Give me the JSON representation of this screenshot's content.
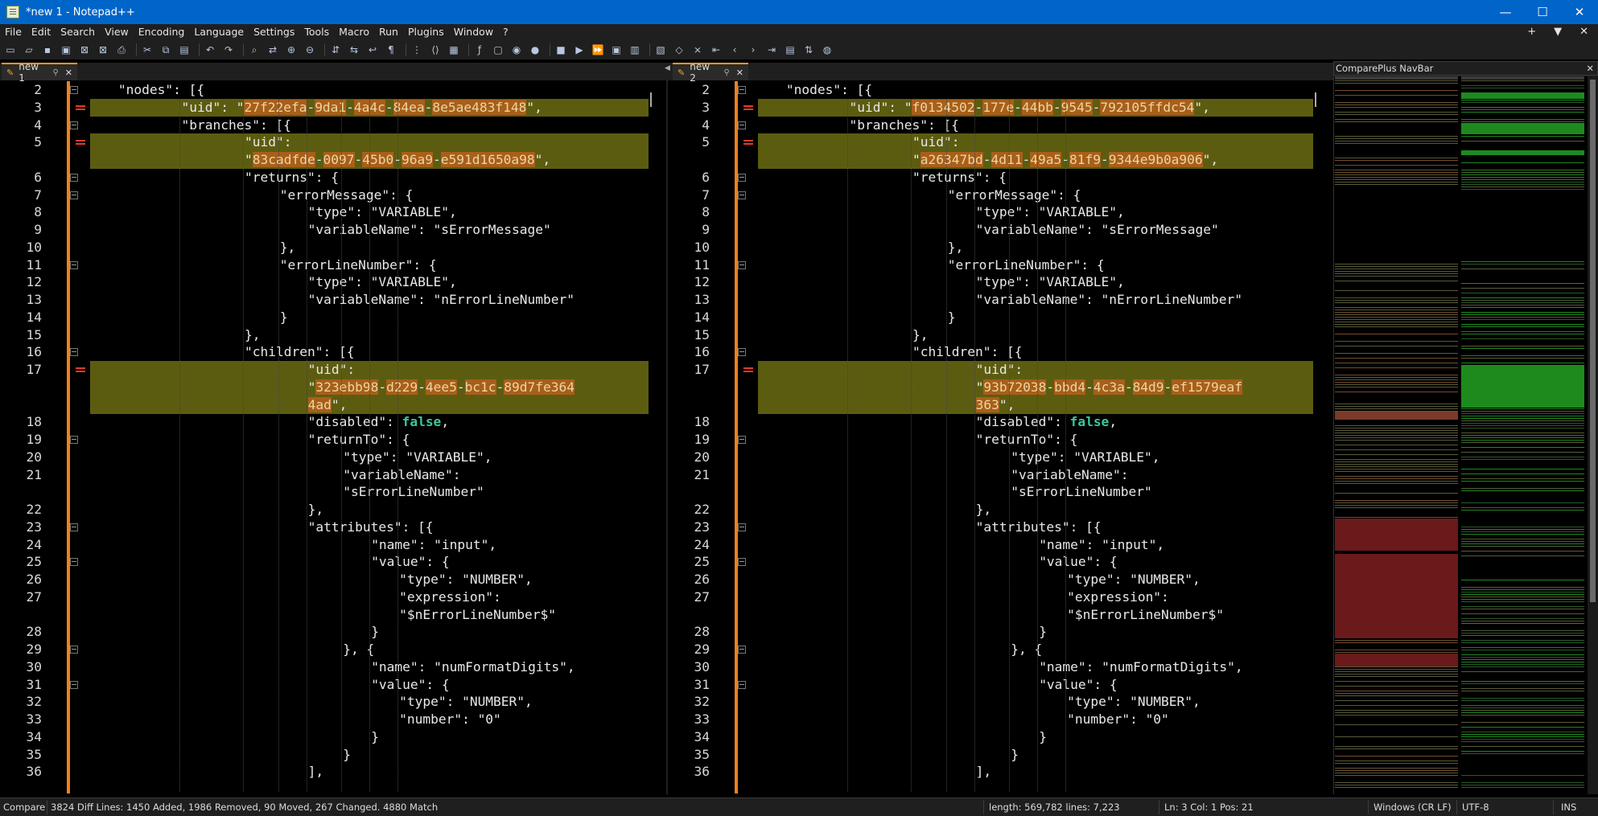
{
  "window": {
    "title": "*new 1 - Notepad++",
    "minimize": "—",
    "maximize": "☐",
    "close": "✕"
  },
  "menu": [
    "File",
    "Edit",
    "Search",
    "View",
    "Encoding",
    "Language",
    "Settings",
    "Tools",
    "Macro",
    "Run",
    "Plugins",
    "Window",
    "?"
  ],
  "menu_right": {
    "add": "+",
    "dropdown": "▼",
    "close": "✕"
  },
  "tabs": {
    "left": {
      "label": "new 1"
    },
    "right": {
      "label": "new 2"
    }
  },
  "navbar": {
    "title": "ComparePlus NavBar"
  },
  "left_pane": {
    "lines": [
      {
        "n": "2",
        "indent": 4,
        "text": "\"nodes\": [{",
        "kind": "plain",
        "fold": true
      },
      {
        "n": "3",
        "indent": 13,
        "text": "\"uid\": \"27f22efa-9da1-4a4c-84ea-8e5ae483f148\",",
        "kind": "diff",
        "uid": "27f22efa-9da1-4a4c-84ea-8e5ae483f148",
        "key": "\"uid\": ",
        "tail": ","
      },
      {
        "n": "4",
        "indent": 13,
        "text": "\"branches\": [{",
        "kind": "plain",
        "fold": true
      },
      {
        "n": "5",
        "indent": 22,
        "text": "\"uid\":",
        "kind": "diff",
        "mark": true
      },
      {
        "n": "",
        "indent": 22,
        "text": "\"83cadfde-0097-45b0-96a9-e591d1650a98\",",
        "kind": "diffuid",
        "uid": "83cadfde-0097-45b0-96a9-e591d1650a98",
        "tail": ","
      },
      {
        "n": "6",
        "indent": 22,
        "text": "\"returns\": {",
        "kind": "plain",
        "fold": true
      },
      {
        "n": "7",
        "indent": 27,
        "text": "\"errorMessage\": {",
        "kind": "plain",
        "fold": true
      },
      {
        "n": "8",
        "indent": 31,
        "text": "\"type\": \"VARIABLE\",",
        "kind": "plain"
      },
      {
        "n": "9",
        "indent": 31,
        "text": "\"variableName\": \"sErrorMessage\"",
        "kind": "plain"
      },
      {
        "n": "10",
        "indent": 27,
        "text": "},",
        "kind": "plain"
      },
      {
        "n": "11",
        "indent": 27,
        "text": "\"errorLineNumber\": {",
        "kind": "plain",
        "fold": true
      },
      {
        "n": "12",
        "indent": 31,
        "text": "\"type\": \"VARIABLE\",",
        "kind": "plain"
      },
      {
        "n": "13",
        "indent": 31,
        "text": "\"variableName\": \"nErrorLineNumber\"",
        "kind": "plain"
      },
      {
        "n": "14",
        "indent": 27,
        "text": "}",
        "kind": "plain"
      },
      {
        "n": "15",
        "indent": 22,
        "text": "},",
        "kind": "plain"
      },
      {
        "n": "16",
        "indent": 22,
        "text": "\"children\": [{",
        "kind": "plain",
        "fold": true
      },
      {
        "n": "17",
        "indent": 31,
        "text": "\"uid\":",
        "kind": "diff",
        "mark": true
      },
      {
        "n": "",
        "indent": 31,
        "text": "\"323ebb98-d229-4ee5-bc1c-89d7fe364",
        "kind": "diffuid",
        "uid": "323ebb98-d229-4ee5-bc1c-89d7fe364",
        "tail": ""
      },
      {
        "n": "",
        "indent": 31,
        "text": "4ad\",",
        "kind": "diffuid",
        "uid": "4ad",
        "tail": ","
      },
      {
        "n": "18",
        "indent": 31,
        "text": "\"disabled\": false,",
        "kind": "bool"
      },
      {
        "n": "19",
        "indent": 31,
        "text": "\"returnTo\": {",
        "kind": "plain",
        "fold": true
      },
      {
        "n": "20",
        "indent": 36,
        "text": "\"type\": \"VARIABLE\",",
        "kind": "plain"
      },
      {
        "n": "21",
        "indent": 36,
        "text": "\"variableName\":",
        "kind": "plain"
      },
      {
        "n": "",
        "indent": 36,
        "text": "\"sErrorLineNumber\"",
        "kind": "plain"
      },
      {
        "n": "22",
        "indent": 31,
        "text": "},",
        "kind": "plain"
      },
      {
        "n": "23",
        "indent": 31,
        "text": "\"attributes\": [{",
        "kind": "plain",
        "fold": true
      },
      {
        "n": "24",
        "indent": 40,
        "text": "\"name\": \"input\",",
        "kind": "plain"
      },
      {
        "n": "25",
        "indent": 40,
        "text": "\"value\": {",
        "kind": "plain",
        "fold": true
      },
      {
        "n": "26",
        "indent": 44,
        "text": "\"type\": \"NUMBER\",",
        "kind": "plain"
      },
      {
        "n": "27",
        "indent": 44,
        "text": "\"expression\":",
        "kind": "plain"
      },
      {
        "n": "",
        "indent": 44,
        "text": "\"$nErrorLineNumber$\"",
        "kind": "plain"
      },
      {
        "n": "28",
        "indent": 40,
        "text": "}",
        "kind": "plain"
      },
      {
        "n": "29",
        "indent": 36,
        "text": "}, {",
        "kind": "plain",
        "fold": true
      },
      {
        "n": "30",
        "indent": 40,
        "text": "\"name\": \"numFormatDigits\",",
        "kind": "plain"
      },
      {
        "n": "31",
        "indent": 40,
        "text": "\"value\": {",
        "kind": "plain",
        "fold": true
      },
      {
        "n": "32",
        "indent": 44,
        "text": "\"type\": \"NUMBER\",",
        "kind": "plain"
      },
      {
        "n": "33",
        "indent": 44,
        "text": "\"number\": \"0\"",
        "kind": "plain"
      },
      {
        "n": "34",
        "indent": 40,
        "text": "}",
        "kind": "plain"
      },
      {
        "n": "35",
        "indent": 36,
        "text": "}",
        "kind": "plain"
      },
      {
        "n": "36",
        "indent": 31,
        "text": "],",
        "kind": "plain"
      }
    ]
  },
  "right_pane": {
    "lines": [
      {
        "n": "2",
        "indent": 4,
        "text": "\"nodes\": [{",
        "kind": "plain",
        "fold": true
      },
      {
        "n": "3",
        "indent": 13,
        "text": "\"uid\": \"f0134502-177e-44bb-9545-792105ffdc54\",",
        "kind": "diff",
        "uid": "f0134502-177e-44bb-9545-792105ffdc54",
        "key": "\"uid\": ",
        "tail": ","
      },
      {
        "n": "4",
        "indent": 13,
        "text": "\"branches\": [{",
        "kind": "plain",
        "fold": true
      },
      {
        "n": "5",
        "indent": 22,
        "text": "\"uid\":",
        "kind": "diff",
        "mark": true
      },
      {
        "n": "",
        "indent": 22,
        "text": "\"a26347bd-4d11-49a5-81f9-9344e9b0a906\",",
        "kind": "diffuid",
        "uid": "a26347bd-4d11-49a5-81f9-9344e9b0a906",
        "tail": ","
      },
      {
        "n": "6",
        "indent": 22,
        "text": "\"returns\": {",
        "kind": "plain",
        "fold": true
      },
      {
        "n": "7",
        "indent": 27,
        "text": "\"errorMessage\": {",
        "kind": "plain",
        "fold": true
      },
      {
        "n": "8",
        "indent": 31,
        "text": "\"type\": \"VARIABLE\",",
        "kind": "plain"
      },
      {
        "n": "9",
        "indent": 31,
        "text": "\"variableName\": \"sErrorMessage\"",
        "kind": "plain"
      },
      {
        "n": "10",
        "indent": 27,
        "text": "},",
        "kind": "plain"
      },
      {
        "n": "11",
        "indent": 27,
        "text": "\"errorLineNumber\": {",
        "kind": "plain",
        "fold": true
      },
      {
        "n": "12",
        "indent": 31,
        "text": "\"type\": \"VARIABLE\",",
        "kind": "plain"
      },
      {
        "n": "13",
        "indent": 31,
        "text": "\"variableName\": \"nErrorLineNumber\"",
        "kind": "plain"
      },
      {
        "n": "14",
        "indent": 27,
        "text": "}",
        "kind": "plain"
      },
      {
        "n": "15",
        "indent": 22,
        "text": "},",
        "kind": "plain"
      },
      {
        "n": "16",
        "indent": 22,
        "text": "\"children\": [{",
        "kind": "plain",
        "fold": true
      },
      {
        "n": "17",
        "indent": 31,
        "text": "\"uid\":",
        "kind": "diff",
        "mark": true
      },
      {
        "n": "",
        "indent": 31,
        "text": "\"93b72038-bbd4-4c3a-84d9-ef1579eaf",
        "kind": "diffuid",
        "uid": "93b72038-bbd4-4c3a-84d9-ef1579eaf",
        "tail": ""
      },
      {
        "n": "",
        "indent": 31,
        "text": "363\",",
        "kind": "diffuid",
        "uid": "363",
        "tail": ","
      },
      {
        "n": "18",
        "indent": 31,
        "text": "\"disabled\": false,",
        "kind": "bool"
      },
      {
        "n": "19",
        "indent": 31,
        "text": "\"returnTo\": {",
        "kind": "plain",
        "fold": true
      },
      {
        "n": "20",
        "indent": 36,
        "text": "\"type\": \"VARIABLE\",",
        "kind": "plain"
      },
      {
        "n": "21",
        "indent": 36,
        "text": "\"variableName\":",
        "kind": "plain"
      },
      {
        "n": "",
        "indent": 36,
        "text": "\"sErrorLineNumber\"",
        "kind": "plain"
      },
      {
        "n": "22",
        "indent": 31,
        "text": "},",
        "kind": "plain"
      },
      {
        "n": "23",
        "indent": 31,
        "text": "\"attributes\": [{",
        "kind": "plain",
        "fold": true
      },
      {
        "n": "24",
        "indent": 40,
        "text": "\"name\": \"input\",",
        "kind": "plain"
      },
      {
        "n": "25",
        "indent": 40,
        "text": "\"value\": {",
        "kind": "plain",
        "fold": true
      },
      {
        "n": "26",
        "indent": 44,
        "text": "\"type\": \"NUMBER\",",
        "kind": "plain"
      },
      {
        "n": "27",
        "indent": 44,
        "text": "\"expression\":",
        "kind": "plain"
      },
      {
        "n": "",
        "indent": 44,
        "text": "\"$nErrorLineNumber$\"",
        "kind": "plain"
      },
      {
        "n": "28",
        "indent": 40,
        "text": "}",
        "kind": "plain"
      },
      {
        "n": "29",
        "indent": 36,
        "text": "}, {",
        "kind": "plain",
        "fold": true
      },
      {
        "n": "30",
        "indent": 40,
        "text": "\"name\": \"numFormatDigits\",",
        "kind": "plain"
      },
      {
        "n": "31",
        "indent": 40,
        "text": "\"value\": {",
        "kind": "plain",
        "fold": true
      },
      {
        "n": "32",
        "indent": 44,
        "text": "\"type\": \"NUMBER\",",
        "kind": "plain"
      },
      {
        "n": "33",
        "indent": 44,
        "text": "\"number\": \"0\"",
        "kind": "plain"
      },
      {
        "n": "34",
        "indent": 40,
        "text": "}",
        "kind": "plain"
      },
      {
        "n": "35",
        "indent": 36,
        "text": "}",
        "kind": "plain"
      },
      {
        "n": "36",
        "indent": 31,
        "text": "],",
        "kind": "plain"
      }
    ]
  },
  "status": {
    "compare": "Compare",
    "diff": "3824 Diff Lines: 1450 Added, 1986 Removed, 90 Moved, 267 Changed.   4880 Match",
    "length": "length: 569,782    lines: 7,223",
    "pos": "Ln: 3    Col: 1    Pos: 21",
    "eol": "Windows (CR LF)",
    "enc": "UTF-8",
    "ins": "INS"
  },
  "colors": {
    "title_bar": "#0065c8",
    "diff_line": "#5c5c11",
    "diff_word": "#a85f1a",
    "change_marker": "#e03a2a",
    "navbar_added": "#1e8a1e",
    "navbar_removed": "#6a1a1a"
  },
  "toolbar_icons": [
    "new-file",
    "open",
    "save",
    "save-all",
    "close",
    "close-all",
    "print",
    "cut",
    "copy",
    "paste",
    "undo",
    "redo",
    "find",
    "replace",
    "zoom-in",
    "zoom-out",
    "sync-v",
    "sync-h",
    "wrap",
    "show-all",
    "indent-guide",
    "udl",
    "doc-map",
    "func-list",
    "folder-workspace",
    "monitor",
    "record",
    "stop",
    "play",
    "play-multi",
    "save-macro",
    "compare",
    "compare-sel",
    "find-unique",
    "clear",
    "first",
    "prev",
    "next",
    "last",
    "nav-bar",
    "sync-scroll",
    "github"
  ]
}
